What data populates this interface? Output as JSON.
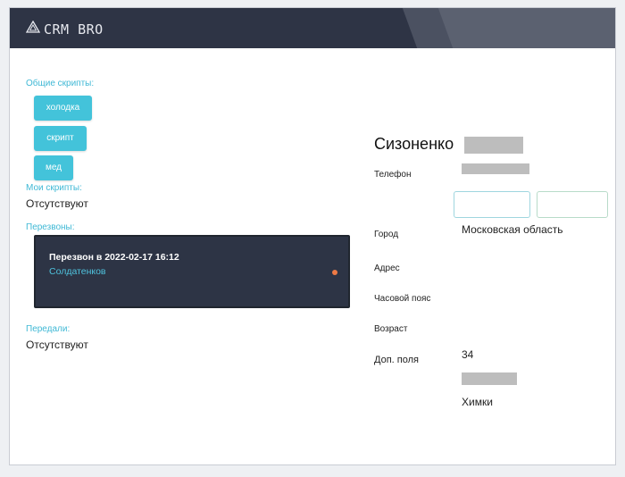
{
  "app": {
    "logo_text": "CRM BRO"
  },
  "scripts": {
    "common_label": "Общие скрипты:",
    "common_items": [
      "холодка",
      "скрипт",
      "мед"
    ],
    "my_label": "Мои скрипты:",
    "my_value": "Отсутствуют"
  },
  "callbacks": {
    "label": "Перезвоны:",
    "card_title": "Перезвон в 2022-02-17 16:12",
    "card_name": "Солдатенков"
  },
  "transferred": {
    "label": "Передали:",
    "value": "Отсутствуют"
  },
  "client": {
    "surname": "Сизоненко",
    "phone_label": "Телефон",
    "city_label": "Город",
    "city_value": "Московская область",
    "address_label": "Адрес",
    "timezone_label": "Часовой пояс",
    "age_label": "Возраст",
    "age_value": "34",
    "extra_label": "Доп. поля",
    "extra_city": "Химки"
  },
  "colors": {
    "accent": "#43c3da",
    "header": "#2e3445",
    "status_dot": "#ee7a45"
  }
}
